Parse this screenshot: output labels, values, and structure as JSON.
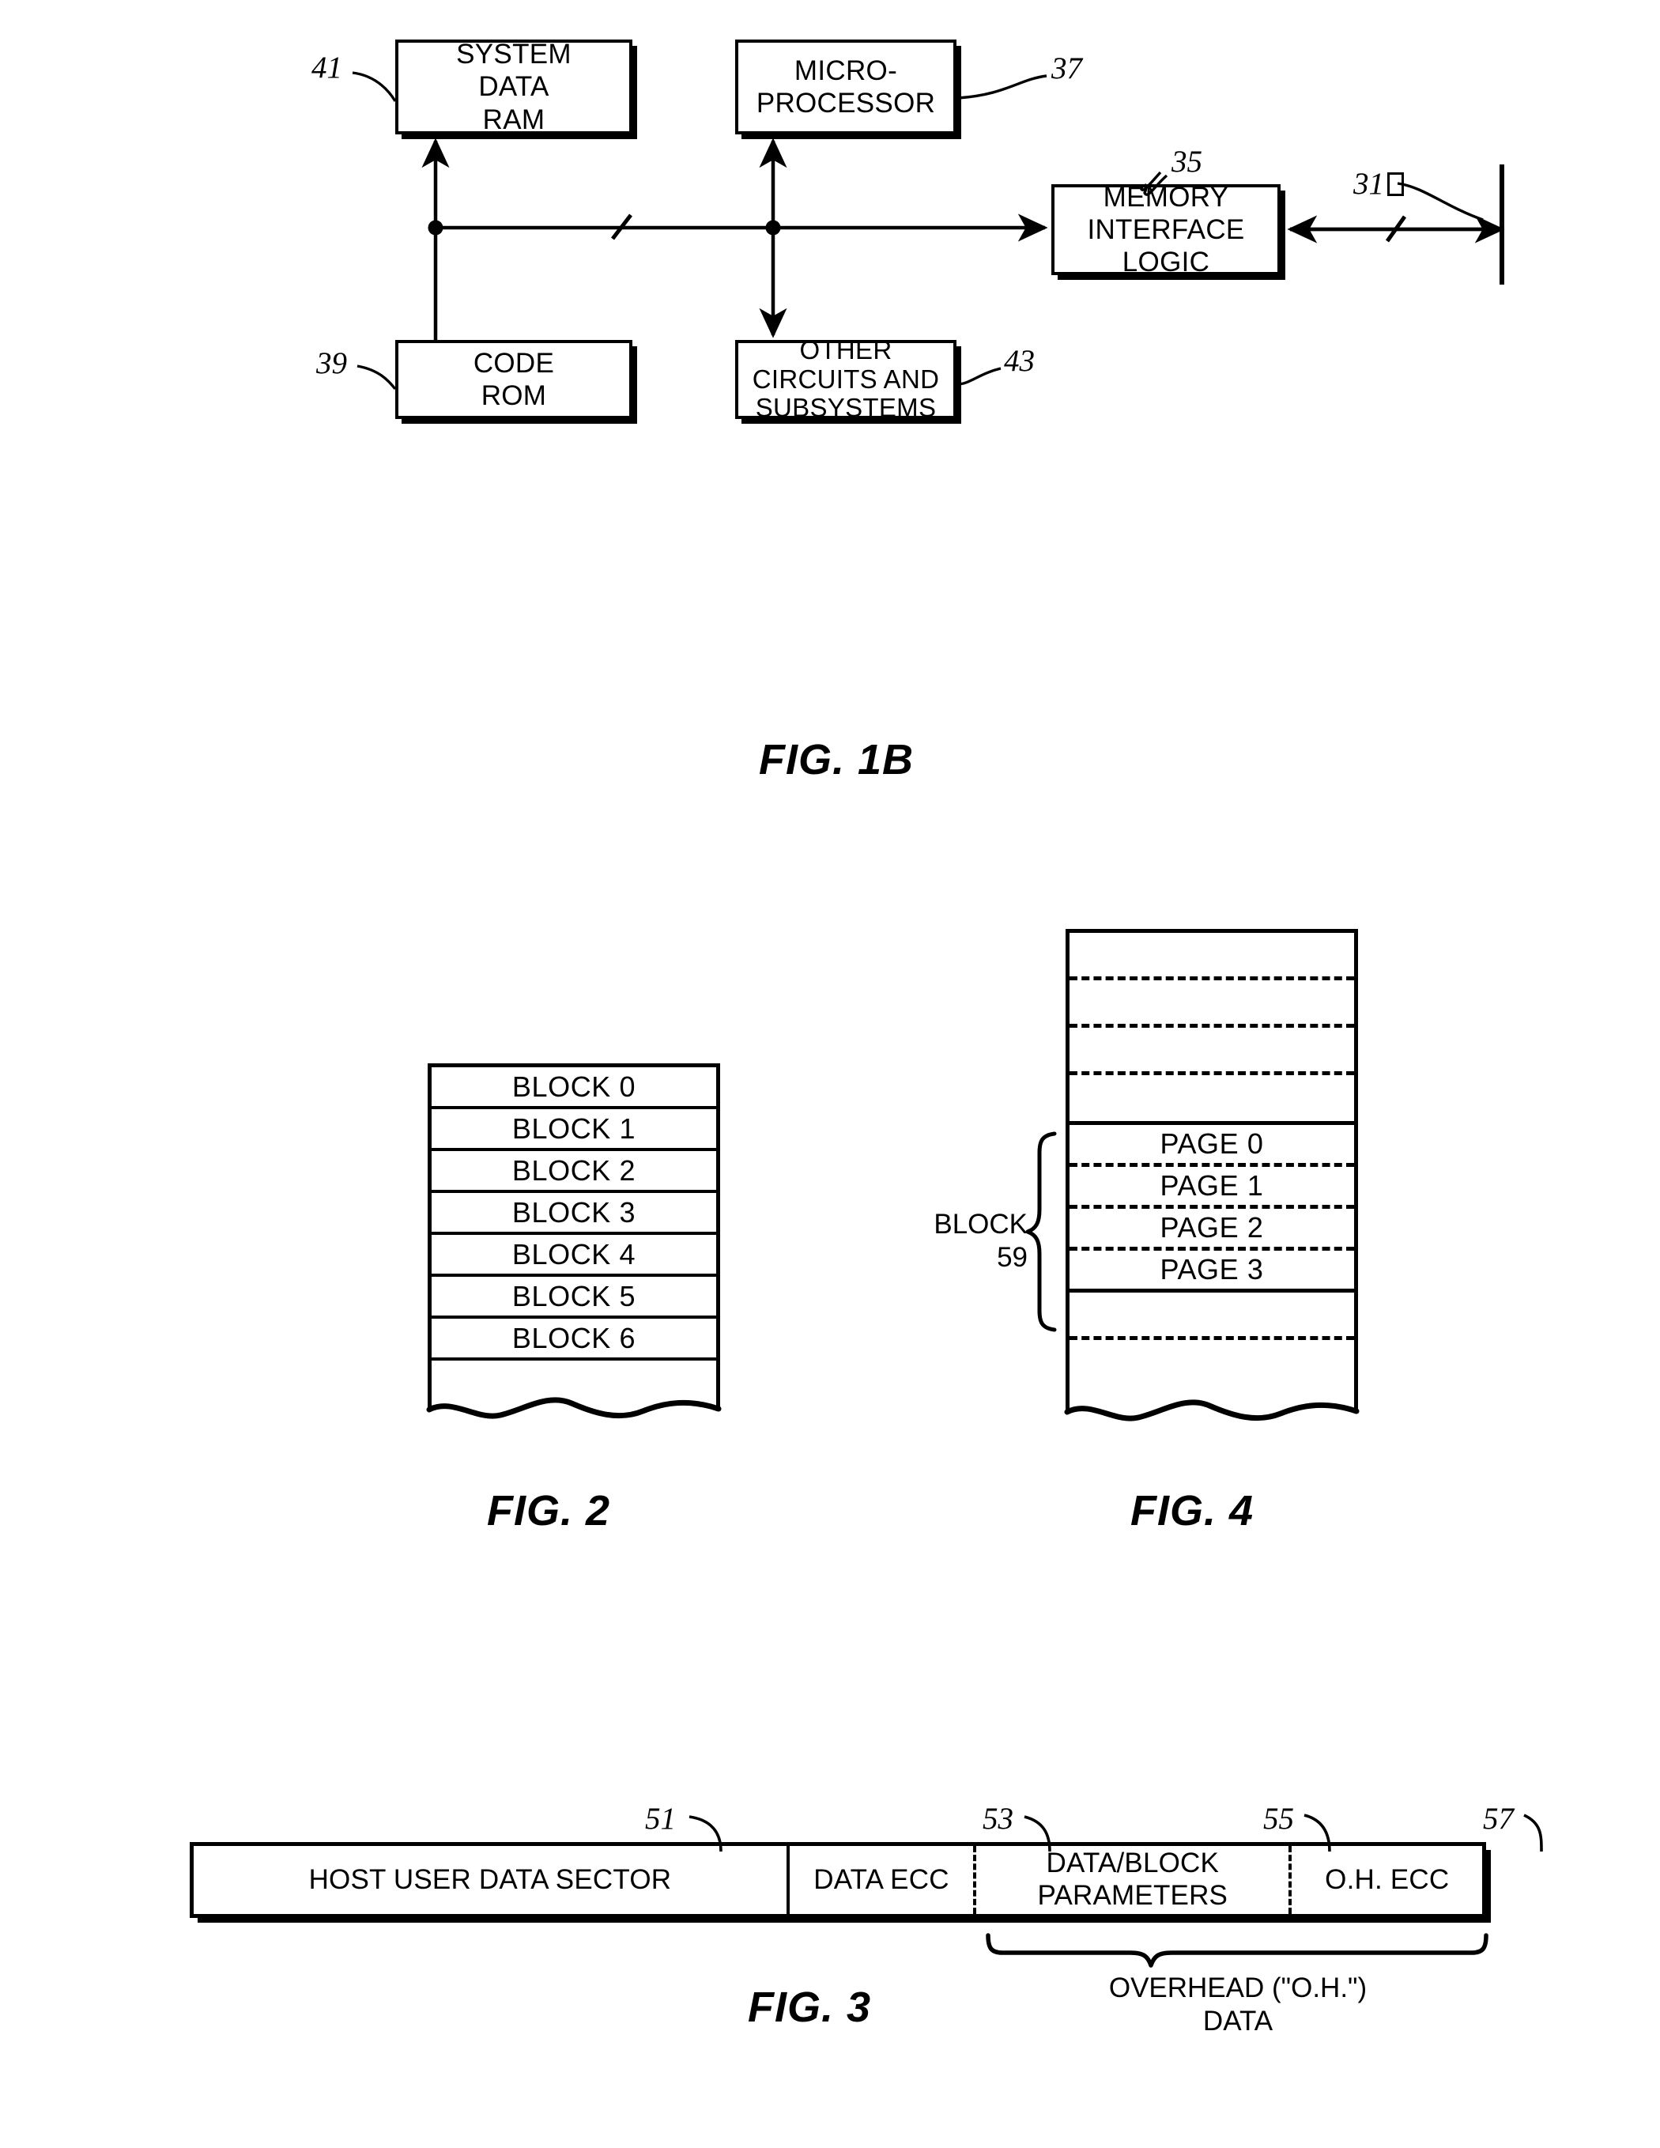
{
  "figures": {
    "fig1b": {
      "caption": "FIG. 1B",
      "blocks": [
        {
          "id": "system-data-ram",
          "label": "SYSTEM\nDATA\nRAM",
          "ref": "41"
        },
        {
          "id": "microprocessor",
          "label": "MICRO-\nPROCESSOR",
          "ref": "37"
        },
        {
          "id": "memory-interface-logic",
          "label": "MEMORY\nINTERFACE\nLOGIC",
          "ref": "35"
        },
        {
          "id": "code-rom",
          "label": "CODE\nROM",
          "ref": "39"
        },
        {
          "id": "other-circuits",
          "label": "OTHER\nCIRCUITS AND\nSUBSYSTEMS",
          "ref": "43"
        }
      ],
      "bus_ref": "31",
      "bus_ref_glyph": "missing-character-box"
    },
    "fig2": {
      "caption": "FIG. 2",
      "rows": [
        "BLOCK 0",
        "BLOCK 1",
        "BLOCK 2",
        "BLOCK 3",
        "BLOCK 4",
        "BLOCK 5",
        "BLOCK 6"
      ]
    },
    "fig4": {
      "caption": "FIG. 4",
      "brace_label": "BLOCK\n59",
      "pages": [
        "PAGE 0",
        "PAGE 1",
        "PAGE 2",
        "PAGE 3"
      ]
    },
    "fig3": {
      "caption": "FIG. 3",
      "cells": [
        {
          "label": "HOST USER DATA SECTOR",
          "ref": "51"
        },
        {
          "label": "DATA ECC",
          "ref": "53"
        },
        {
          "label": "DATA/BLOCK\nPARAMETERS",
          "ref": "55"
        },
        {
          "label": "O.H. ECC",
          "ref": "57"
        }
      ],
      "brace_caption": "OVERHEAD (\"O.H.\")\nDATA"
    }
  },
  "colors": {
    "ink": "#000000",
    "paper": "#ffffff"
  }
}
